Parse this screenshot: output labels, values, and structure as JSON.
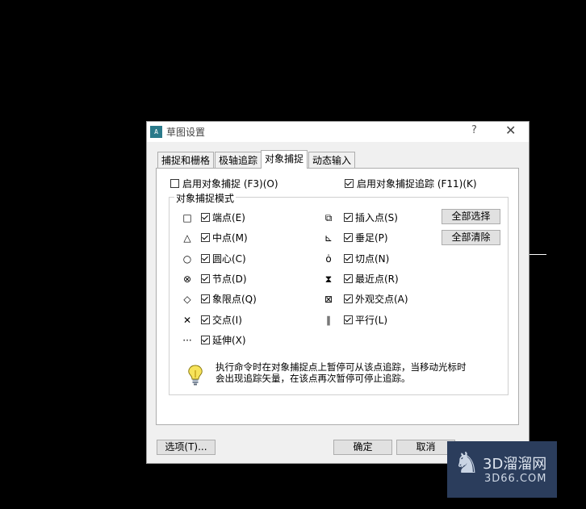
{
  "dialog": {
    "title": "草图设置",
    "help": "?",
    "close": "✕",
    "app_icon_text": "A"
  },
  "tabs": [
    {
      "label": "捕捉和栅格"
    },
    {
      "label": "极轴追踪"
    },
    {
      "label": "对象捕捉"
    },
    {
      "label": "动态输入"
    }
  ],
  "options": {
    "enable_osnap": {
      "label": "启用对象捕捉 (F3)(O)",
      "checked": false
    },
    "enable_osnap_tracking": {
      "label": "启用对象捕捉追踪 (F11)(K)",
      "checked": true
    }
  },
  "group": {
    "title": "对象捕捉模式",
    "modes_left": [
      {
        "symbol": "□",
        "label": "端点(E)",
        "checked": true
      },
      {
        "symbol": "△",
        "label": "中点(M)",
        "checked": true
      },
      {
        "symbol": "○",
        "label": "圆心(C)",
        "checked": true
      },
      {
        "symbol": "⊗",
        "label": "节点(D)",
        "checked": true
      },
      {
        "symbol": "◇",
        "label": "象限点(Q)",
        "checked": true
      },
      {
        "symbol": "✕",
        "label": "交点(I)",
        "checked": true
      },
      {
        "symbol": "···",
        "label": "延伸(X)",
        "checked": true
      }
    ],
    "modes_right": [
      {
        "symbol": "⧉",
        "label": "插入点(S)",
        "checked": true
      },
      {
        "symbol": "⊾",
        "label": "垂足(P)",
        "checked": true
      },
      {
        "symbol": "ȯ",
        "label": "切点(N)",
        "checked": true
      },
      {
        "symbol": "⧗",
        "label": "最近点(R)",
        "checked": true
      },
      {
        "symbol": "⊠",
        "label": "外观交点(A)",
        "checked": true
      },
      {
        "symbol": "∥",
        "label": "平行(L)",
        "checked": true
      }
    ],
    "select_all": "全部选择",
    "clear_all": "全部清除",
    "hint_line1": "执行命令时在对象捕捉点上暂停可从该点追踪，当移动光标时",
    "hint_line2": "会出现追踪矢量，在该点再次暂停可停止追踪。"
  },
  "footer": {
    "options": "选项(T)...",
    "ok": "确定",
    "cancel": "取消"
  },
  "watermark": {
    "main": "3D溜溜网",
    "sub": "3D66.COM"
  },
  "colors": {
    "background": "#000000",
    "dialog": "#f0f0f0",
    "panel": "#ffffff",
    "icon_teal": "#2a7a8a",
    "watermark_bg": "#2b3d5c"
  }
}
